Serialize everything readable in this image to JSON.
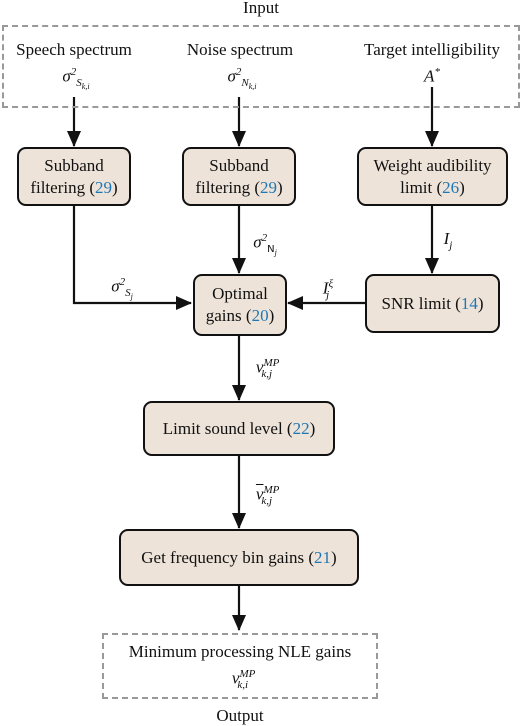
{
  "input_label": "Input",
  "output_label": "Output",
  "inputs": [
    {
      "label": "Speech spectrum",
      "sym": "σ",
      "sup": "2",
      "sub": "S",
      "subsub": "k,i"
    },
    {
      "label": "Noise spectrum",
      "sym": "σ",
      "sup": "2",
      "sub": "N",
      "subsub": "k,i"
    },
    {
      "label": "Target intelligibility",
      "sym": "A",
      "sup": "*"
    }
  ],
  "boxes": {
    "subband1": {
      "line1": "Subband",
      "line2": "filtering (",
      "ref": "29",
      "close": ")"
    },
    "subband2": {
      "line1": "Subband",
      "line2": "filtering (",
      "ref": "29",
      "close": ")"
    },
    "weight": {
      "line1": "Weight audibility",
      "line2": "limit (",
      "ref": "26",
      "close": ")"
    },
    "optimal": {
      "line1": "Optimal",
      "line2": "gains (",
      "ref": "20",
      "close": ")"
    },
    "snr": {
      "line1": "SNR limit (",
      "ref": "14",
      "close": ")"
    },
    "limit": {
      "line1": "Limit sound level (",
      "ref": "22",
      "close": ")"
    },
    "freq": {
      "line1": "Get frequency bin gains (",
      "ref": "21",
      "close": ")"
    }
  },
  "edges": {
    "sigma_s_j": {
      "sym": "σ",
      "sup": "2",
      "sub": "S",
      "subsub": "j"
    },
    "sigma_n_j": {
      "sym": "σ",
      "sup": "2",
      "sub": "N",
      "subsub": "j"
    },
    "i_j": {
      "sym": "I",
      "sub": "j"
    },
    "i_j_xi": {
      "sym": "I",
      "sup": "ξ",
      "sub": "j"
    },
    "v_mp_kj": {
      "sym": "v",
      "sup": "MP",
      "sub": "k,j"
    },
    "vbar_mp_kj": {
      "sym": "v",
      "sup": "MP",
      "sub": "k,j"
    }
  },
  "output": {
    "label": "Minimum processing NLE gains",
    "sym": "v",
    "sup": "MP",
    "sub": "k,i"
  },
  "colors": {
    "box_fill": "#ede3d9",
    "ref": "#1f77b4",
    "dashed": "#999999"
  }
}
